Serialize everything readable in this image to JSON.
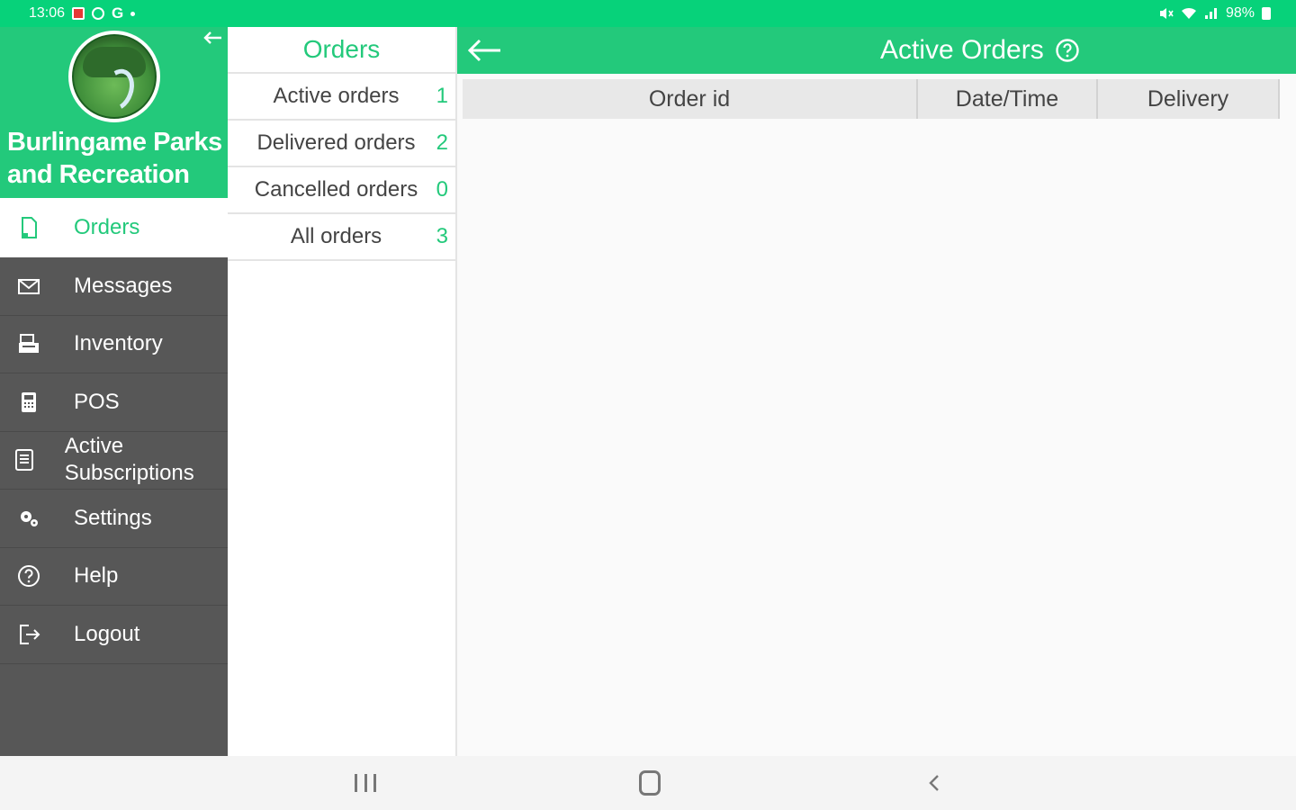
{
  "status_bar": {
    "time": "13:06",
    "google_letter": "G",
    "battery": "98%"
  },
  "brand": {
    "name": "Burlingame Parks and Recreation"
  },
  "sidebar": {
    "items": [
      {
        "label": "Orders",
        "icon": "orders-icon",
        "active": true
      },
      {
        "label": "Messages",
        "icon": "envelope-icon",
        "active": false
      },
      {
        "label": "Inventory",
        "icon": "inventory-icon",
        "active": false
      },
      {
        "label": "POS",
        "icon": "register-icon",
        "active": false
      },
      {
        "label": "Active Subscriptions",
        "icon": "subscriptions-icon",
        "active": false
      },
      {
        "label": "Settings",
        "icon": "gear-icon",
        "active": false
      },
      {
        "label": "Help",
        "icon": "help-icon",
        "active": false
      },
      {
        "label": "Logout",
        "icon": "logout-icon",
        "active": false
      }
    ]
  },
  "orders_panel": {
    "title": "Orders",
    "rows": [
      {
        "label": "Active orders",
        "count": "1"
      },
      {
        "label": "Delivered orders",
        "count": "2"
      },
      {
        "label": "Cancelled orders",
        "count": "0"
      },
      {
        "label": "All orders",
        "count": "3"
      }
    ]
  },
  "main": {
    "title": "Active Orders",
    "columns": [
      "Order id",
      "Date/Time",
      "Delivery"
    ]
  },
  "colors": {
    "accent": "#23c97b",
    "status_bar": "#07d27a",
    "sidebar_bg": "#575757"
  }
}
